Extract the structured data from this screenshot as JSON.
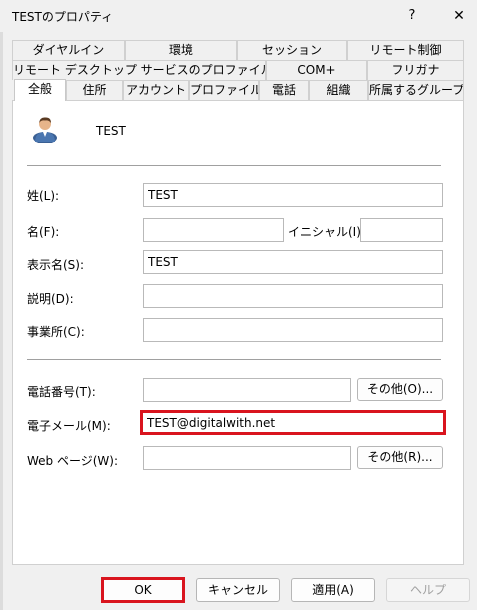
{
  "window": {
    "title": "TESTのプロパティ",
    "help_glyph": "?",
    "close_glyph": "✕"
  },
  "tabs": {
    "row1": [
      "ダイヤルイン",
      "環境",
      "セッション",
      "リモート制御"
    ],
    "row2": [
      "リモート デスクトップ サービスのプロファイル",
      "COM+",
      "フリガナ"
    ],
    "row3": [
      "全般",
      "住所",
      "アカウント",
      "プロファイル",
      "電話",
      "組織",
      "所属するグループ"
    ],
    "active": "全般"
  },
  "general": {
    "user_name": "TEST",
    "fields": {
      "last_name_label": "姓(L):",
      "last_name": "TEST",
      "first_name_label": "名(F):",
      "first_name": "",
      "initials_label": "イニシャル(I):",
      "initials": "",
      "display_name_label": "表示名(S):",
      "display_name": "TEST",
      "description_label": "説明(D):",
      "description": "",
      "office_label": "事業所(C):",
      "office": "",
      "phone_label": "電話番号(T):",
      "phone": "",
      "email_label": "電子メール(M):",
      "email": "TEST@digitalwith.net",
      "webpage_label": "Web ページ(W):",
      "webpage": ""
    },
    "other_phone_label": "その他(O)...",
    "other_web_label": "その他(R)..."
  },
  "buttons": {
    "ok": "OK",
    "cancel": "キャンセル",
    "apply": "適用(A)",
    "help": "ヘルプ"
  },
  "colors": {
    "highlight": "#d9141e",
    "window_bg": "#f0f0f0"
  }
}
